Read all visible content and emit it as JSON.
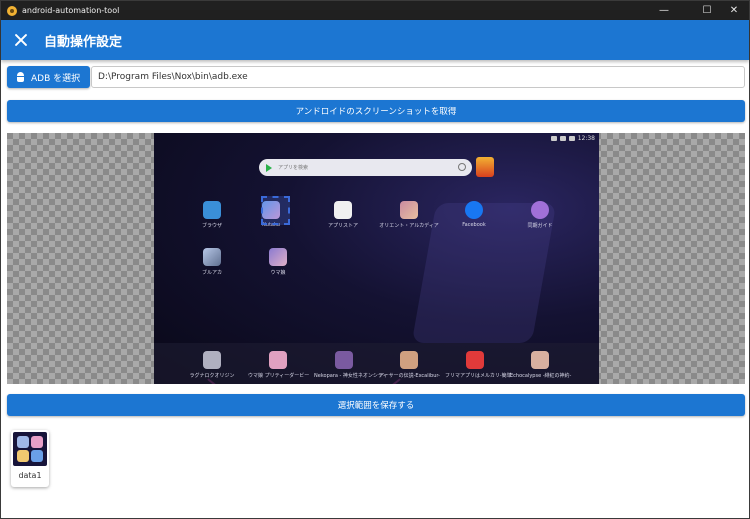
{
  "window": {
    "title": "android-automation-tool",
    "controls": [
      "—",
      "☐",
      "✕"
    ]
  },
  "appbar": {
    "title": "自動操作設定"
  },
  "adb": {
    "button_label": "ADB を選択",
    "path": "D:\\Program Files\\Nox\\bin\\adb.exe"
  },
  "capture_button": "アンドロイドのスクリーンショットを取得",
  "save_button": "選択範囲を保存する",
  "emulator": {
    "time": "12:38",
    "search_placeholder": "アプリを検索",
    "apps": [
      {
        "label": "ブラウザ",
        "color": "#3a8fd8"
      },
      {
        "label": "Nutaku",
        "color": "#6aa0e8"
      },
      {
        "label": "アプリストア",
        "color": "#f0f0f0"
      },
      {
        "label": "オリエント・アルカディア",
        "color": "#c98aa0"
      },
      {
        "label": "Facebook",
        "color": "#1877f2"
      },
      {
        "label": "同期ガイド",
        "color": "#a070d8"
      },
      {
        "label": "ブルアカ",
        "color": "#b8c8e8"
      },
      {
        "label": "ウマ娘",
        "color": "#8a7ad0"
      }
    ],
    "dock": [
      {
        "label": "ラグナロクオリジン",
        "color": "#b0b0c0"
      },
      {
        "label": "ウマ娘 プリティーダービー",
        "color": "#e0a0c0"
      },
      {
        "label": "Nekopara - 神女性ネオンシティ",
        "color": "#7a5aa0"
      },
      {
        "label": "アーサーの伝説-Excalibur-",
        "color": "#d0a080"
      },
      {
        "label": "フリマアプリはメルカリ-簡単",
        "color": "#e03a3a"
      },
      {
        "label": "Echocalypse -緋紅の神約-",
        "color": "#d8b0a0"
      }
    ]
  },
  "saved_items": [
    {
      "label": "data1"
    }
  ]
}
